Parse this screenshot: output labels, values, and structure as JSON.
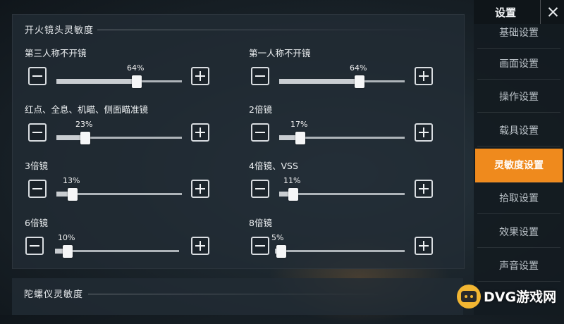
{
  "section": {
    "title": "开火镜头灵敏度",
    "gyro_title": "陀螺仪灵敏度"
  },
  "sliders": [
    {
      "label": "第三人称不开镜",
      "value": 64,
      "value_text": "64%"
    },
    {
      "label": "第一人称不开镜",
      "value": 64,
      "value_text": "64%"
    },
    {
      "label": "红点、全息、机瞄、侧面瞄准镜",
      "value": 23,
      "value_text": "23%"
    },
    {
      "label": "2倍镜",
      "value": 17,
      "value_text": "17%"
    },
    {
      "label": "3倍镜",
      "value": 13,
      "value_text": "13%"
    },
    {
      "label": "4倍镜、VSS",
      "value": 11,
      "value_text": "11%"
    },
    {
      "label": "6倍镜",
      "value": 10,
      "value_text": "10%"
    },
    {
      "label": "8倍镜",
      "value": 5,
      "value_text": "5%"
    }
  ],
  "sidebar": {
    "title": "设置",
    "items": [
      {
        "label": "基础设置",
        "active": false
      },
      {
        "label": "画面设置",
        "active": false
      },
      {
        "label": "操作设置",
        "active": false
      },
      {
        "label": "载具设置",
        "active": false
      },
      {
        "label": "灵敏度设置",
        "active": true
      },
      {
        "label": "拾取设置",
        "active": false
      },
      {
        "label": "效果设置",
        "active": false
      },
      {
        "label": "声音设置",
        "active": false
      }
    ]
  },
  "watermark": {
    "text": "DVG游戏网"
  },
  "colors": {
    "accent": "#ef8a1d",
    "panel": "#222c34",
    "text": "#e6e9ec"
  },
  "icons": {
    "minus": "minus-icon",
    "plus": "plus-icon",
    "close": "close-icon"
  }
}
